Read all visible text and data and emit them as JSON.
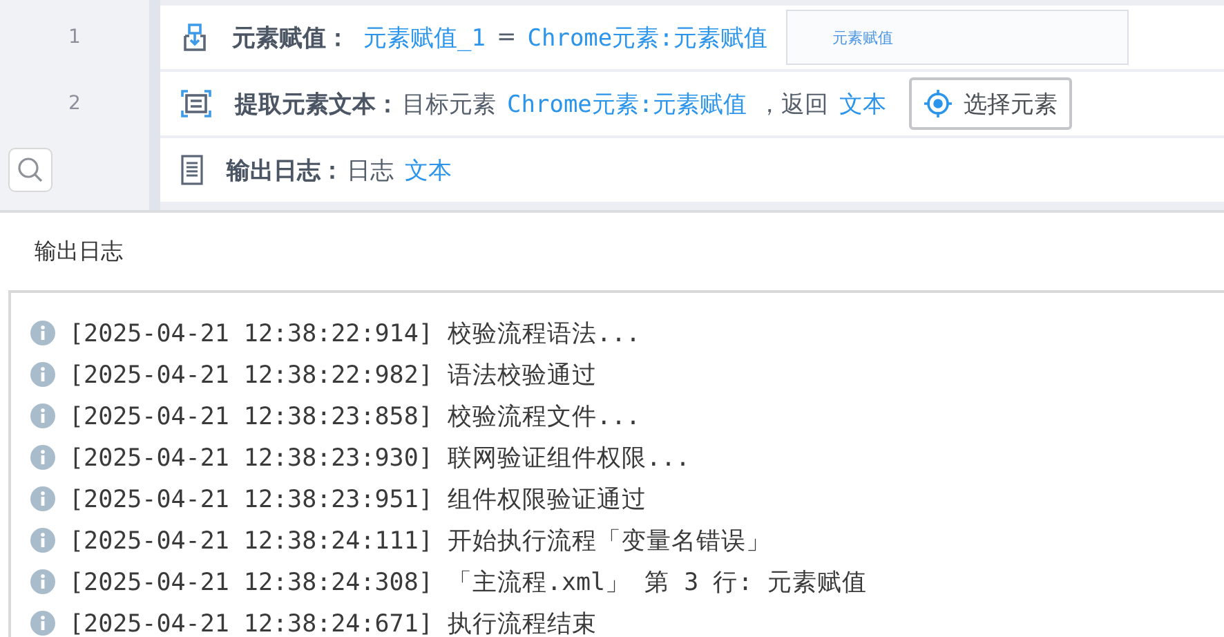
{
  "steps": [
    {
      "number": "1",
      "kind": "assign",
      "segments": [
        {
          "kind": "label",
          "text": "元素赋值："
        },
        {
          "kind": "var",
          "text": "元素赋值_1"
        },
        {
          "kind": "plain",
          "text": "="
        },
        {
          "kind": "var",
          "text": "Chrome元素:元素赋值"
        }
      ],
      "preview": {
        "text": "元素赋值"
      }
    },
    {
      "number": "2",
      "kind": "extract",
      "segments": [
        {
          "kind": "label",
          "text": "提取元素文本："
        },
        {
          "kind": "plain",
          "text": "目标元素"
        },
        {
          "kind": "var",
          "text": "Chrome元素:元素赋值"
        },
        {
          "kind": "plain",
          "text": "，返回"
        },
        {
          "kind": "var",
          "text": "文本"
        }
      ],
      "button": "选择元素"
    },
    {
      "kind": "log",
      "segments": [
        {
          "kind": "label",
          "text": "输出日志："
        },
        {
          "kind": "plain",
          "text": "日志"
        },
        {
          "kind": "var",
          "text": "文本"
        }
      ]
    }
  ],
  "output_panel": {
    "title": "输出日志",
    "entries": [
      {
        "kind": "info",
        "text": "[2025-04-21 12:38:22:914] 校验流程语法..."
      },
      {
        "kind": "info",
        "text": "[2025-04-21 12:38:22:982] 语法校验通过"
      },
      {
        "kind": "info",
        "text": "[2025-04-21 12:38:23:858] 校验流程文件..."
      },
      {
        "kind": "info",
        "text": "[2025-04-21 12:38:23:930] 联网验证组件权限..."
      },
      {
        "kind": "info",
        "text": "[2025-04-21 12:38:23:951] 组件权限验证通过"
      },
      {
        "kind": "info",
        "text": "[2025-04-21 12:38:24:111] 开始执行流程「变量名错误」"
      },
      {
        "kind": "info",
        "text": "[2025-04-21 12:38:24:308] 「主流程.xml」 第 3 行: 元素赋值"
      },
      {
        "kind": "info",
        "text": "[2025-04-21 12:38:24:671] 执行流程结束"
      }
    ]
  }
}
